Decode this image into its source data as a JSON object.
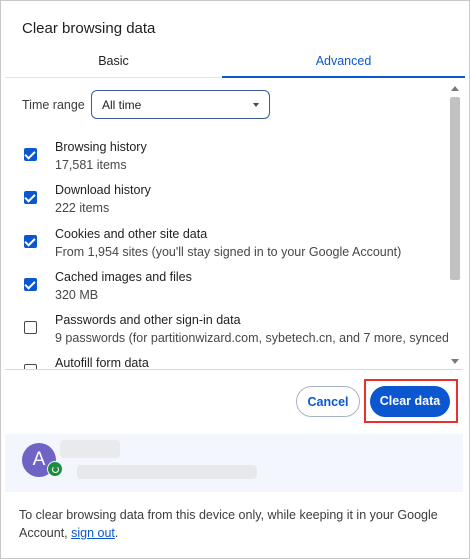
{
  "dialog": {
    "title": "Clear browsing data"
  },
  "tabs": [
    {
      "label": "Basic",
      "selected": false
    },
    {
      "label": "Advanced",
      "selected": true
    }
  ],
  "time_range": {
    "label": "Time range",
    "value": "All time"
  },
  "items": [
    {
      "name": "Browsing history",
      "desc": "17,581 items",
      "checked": true
    },
    {
      "name": "Download history",
      "desc": "222 items",
      "checked": true
    },
    {
      "name": "Cookies and other site data",
      "desc": "From 1,954 sites (you'll stay signed in to your Google Account)",
      "checked": true
    },
    {
      "name": "Cached images and files",
      "desc": "320 MB",
      "checked": true
    },
    {
      "name": "Passwords and other sign-in data",
      "desc": "9 passwords (for partitionwizard.com, sybetech.cn, and 7 more, synced)",
      "checked": false
    },
    {
      "name": "Autofill form data",
      "desc": "",
      "checked": false
    }
  ],
  "buttons": {
    "cancel": "Cancel",
    "clear": "Clear data"
  },
  "account": {
    "avatar_letter": "A"
  },
  "footer": {
    "text_before": "To clear browsing data from this device only, while keeping it in your Google Account, ",
    "link": "sign out",
    "text_after": "."
  },
  "colors": {
    "accent": "#0b57d0",
    "highlight": "#e8312f",
    "avatar": "#6f64c4",
    "sync": "#1e8e3e"
  }
}
